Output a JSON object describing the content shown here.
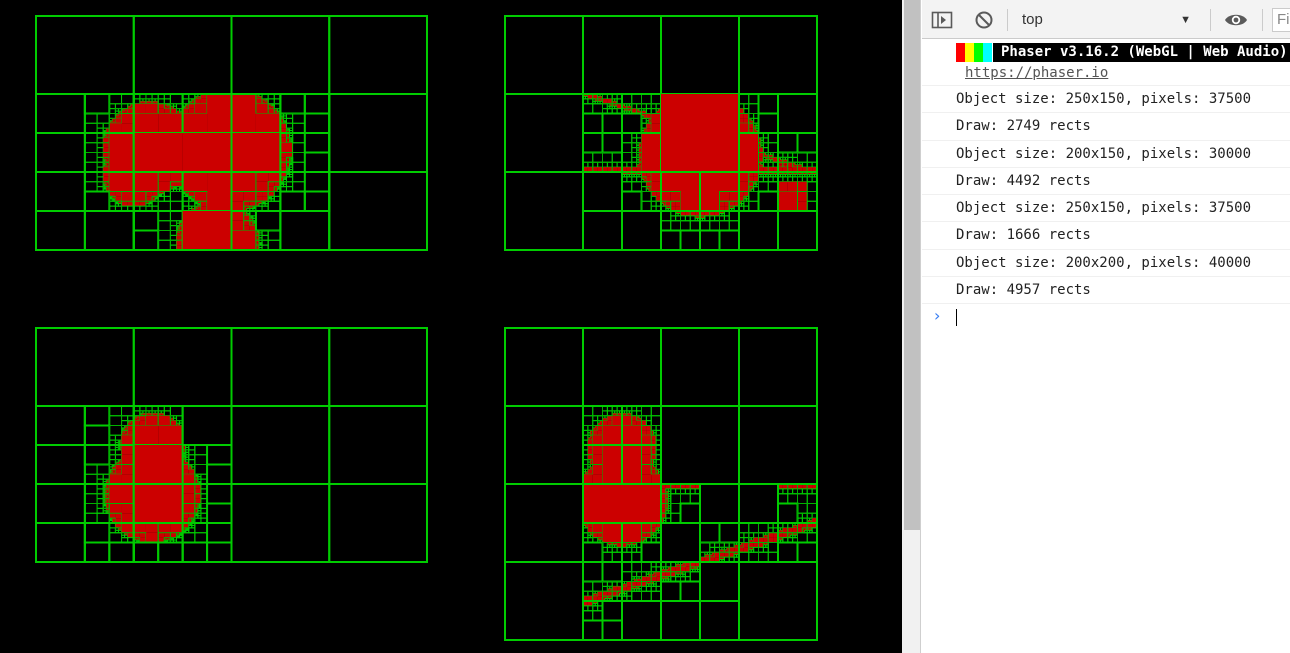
{
  "canvas": {
    "background": "#000000",
    "grid_color": "#00cc00",
    "fill_color": "#cc0000",
    "panels": [
      {
        "name": "panel-top-left"
      },
      {
        "name": "panel-top-right"
      },
      {
        "name": "panel-bottom-left"
      },
      {
        "name": "panel-bottom-right"
      }
    ]
  },
  "devtools": {
    "toolbar": {
      "sidebar_icon": "sidebar-toggle-icon",
      "clear_icon": "clear-console-icon",
      "context_value": "top",
      "context_arrow": "▼",
      "eye_icon": "eye-icon",
      "filter_placeholder": "Fi"
    },
    "banner": {
      "colors": [
        "#ff0000",
        "#ffff00",
        "#00ff00",
        "#00ffff"
      ],
      "text": "Phaser v3.16.2 (WebGL | Web Audio)",
      "link": "https://phaser.io"
    },
    "messages": [
      "Object size: 250x150, pixels: 37500",
      "Draw: 2749 rects",
      "Object size: 200x150, pixels: 30000",
      "Draw: 4492 rects",
      "Object size: 250x150, pixels: 37500",
      "Draw: 1666 rects",
      "Object size: 200x200, pixels: 40000",
      "Draw: 4957 rects"
    ],
    "prompt_symbol": "›"
  }
}
